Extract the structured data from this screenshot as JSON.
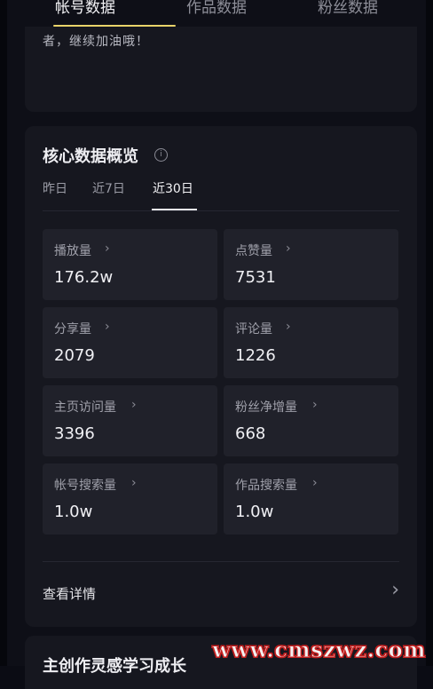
{
  "tabs": [
    "帐号数据",
    "作品数据",
    "粉丝数据"
  ],
  "top_card": {
    "message": "者，继续加油哦！"
  },
  "overview": {
    "title": "核心数据概览",
    "info_icon": "info-icon",
    "ranges": [
      "昨日",
      "近7日",
      "近30日"
    ],
    "active_range": "近30日",
    "metrics": [
      {
        "label": "播放量",
        "value": "176.2w"
      },
      {
        "label": "点赞量",
        "value": "7531"
      },
      {
        "label": "分享量",
        "value": "2079"
      },
      {
        "label": "评论量",
        "value": "1226"
      },
      {
        "label": "主页访问量",
        "value": "3396"
      },
      {
        "label": "粉丝净增量",
        "value": "668"
      },
      {
        "label": "帐号搜索量",
        "value": "1.0w"
      },
      {
        "label": "作品搜索量",
        "value": "1.0w"
      }
    ],
    "details_label": "查看详情"
  },
  "next_section": {
    "title": "主创作灵感学习成长"
  },
  "watermark": "www.cmszwz.com"
}
